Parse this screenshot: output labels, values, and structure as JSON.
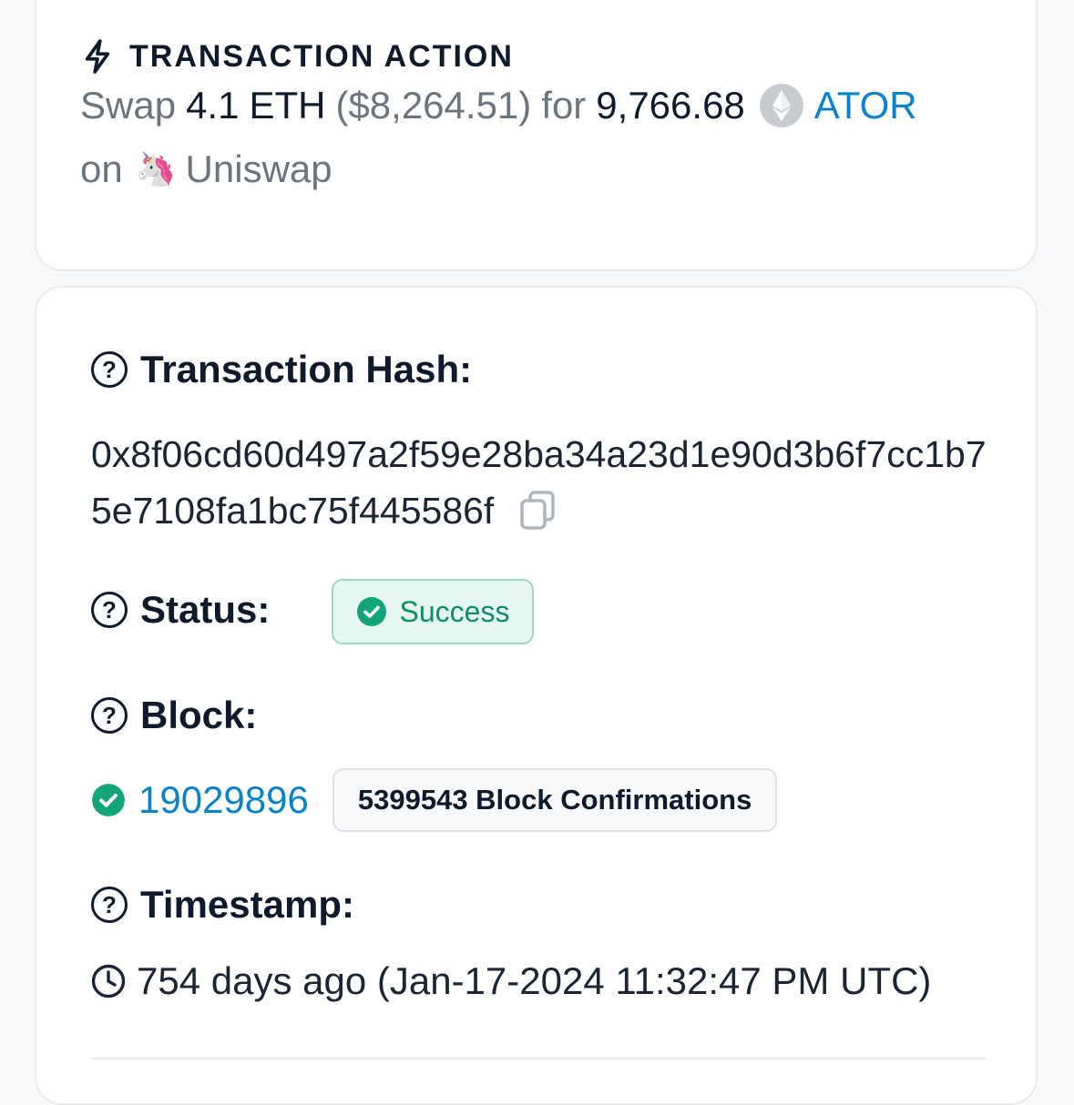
{
  "transaction_action": {
    "title": "TRANSACTION ACTION",
    "swap_word": "Swap",
    "amount_in": "4.1",
    "token_in": "ETH",
    "usd_value": "($8,264.51)",
    "for_word": "for",
    "amount_out": "9,766.68",
    "token_out": "ATOR",
    "on_word": "on",
    "dex_emoji": "🦄",
    "dex_name": "Uniswap"
  },
  "details": {
    "hash_label": "Transaction Hash:",
    "hash_value": "0x8f06cd60d497a2f59e28ba34a23d1e90d3b6f7cc1b75e7108fa1bc75f445586f",
    "status_label": "Status:",
    "status_value": "Success",
    "block_label": "Block:",
    "block_number": "19029896",
    "block_confirmations": "5399543 Block Confirmations",
    "timestamp_label": "Timestamp:",
    "timestamp_value": "754 days ago (Jan-17-2024 11:32:47 PM UTC)",
    "help_icon_glyph": "?"
  },
  "colors": {
    "link": "#0a84c6",
    "success_text": "#0a8f6a",
    "success_bg": "#e6f6f1",
    "success_icon": "#13a57a",
    "muted_text": "#6c757d",
    "dark_text": "#0f1b2d"
  }
}
